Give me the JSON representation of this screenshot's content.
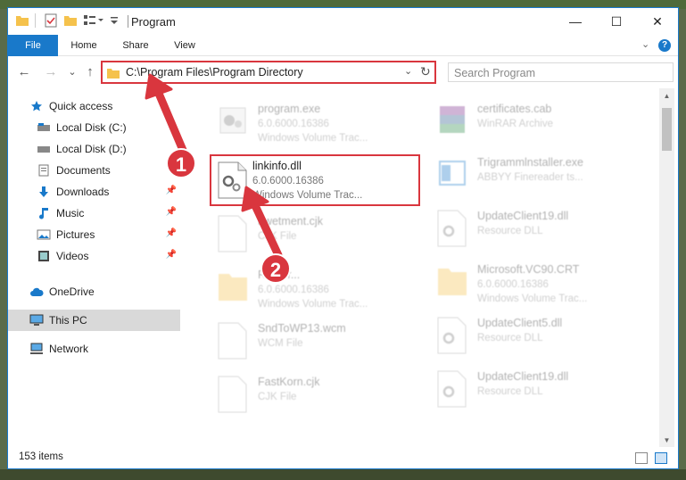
{
  "window": {
    "title": "Program",
    "controls": {
      "minimize": "—",
      "maximize": "☐",
      "close": "✕"
    }
  },
  "ribbon": {
    "tabs": [
      {
        "label": "File"
      },
      {
        "label": "Home"
      },
      {
        "label": "Share"
      },
      {
        "label": "View"
      }
    ],
    "expand": "⌄",
    "help": "?"
  },
  "navigation": {
    "back": "←",
    "forward": "→",
    "recent": "⌄",
    "up": "↑",
    "address": "C:\\Program Files\\Program Directory",
    "address_dropdown": "⌄",
    "refresh": "↻",
    "search_placeholder": "Search Program"
  },
  "sidebar": {
    "items": [
      {
        "label": "Quick access",
        "icon": "star-icon",
        "pinned": false
      },
      {
        "label": "Local Disk (C:)",
        "icon": "drive-icon",
        "pinned": false
      },
      {
        "label": "Local Disk (D:)",
        "icon": "drive-icon",
        "pinned": false
      },
      {
        "label": "Documents",
        "icon": "document-icon",
        "pinned": false
      },
      {
        "label": "Downloads",
        "icon": "download-icon",
        "pinned": true
      },
      {
        "label": "Music",
        "icon": "music-icon",
        "pinned": true
      },
      {
        "label": "Pictures",
        "icon": "picture-icon",
        "pinned": true
      },
      {
        "label": "Videos",
        "icon": "video-icon",
        "pinned": true
      },
      {
        "label": "OneDrive",
        "icon": "cloud-icon",
        "pinned": false
      },
      {
        "label": "This PC",
        "icon": "computer-icon",
        "pinned": false,
        "selected": true
      },
      {
        "label": "Network",
        "icon": "network-icon",
        "pinned": false
      }
    ]
  },
  "files": {
    "left": [
      {
        "name": "program.exe",
        "line2": "6.0.6000.16386",
        "line3": "Windows Volume Trac...",
        "icon": "exe-icon"
      },
      {
        "name": "linkinfo.dll",
        "line2": "6.0.6000.16386",
        "line3": "Windows Volume Trac...",
        "icon": "dll-icon",
        "highlighted": true
      },
      {
        "name": "hwetment.cjk",
        "line2": "CJK File",
        "line3": "",
        "icon": "file-icon"
      },
      {
        "name": "Roamr...",
        "line2": "6.0.6000.16386",
        "line3": "Windows Volume Trac...",
        "icon": "folder-icon"
      },
      {
        "name": "SndToWP13.wcm",
        "line2": "WCM File",
        "line3": "",
        "icon": "file-icon"
      },
      {
        "name": "FastKorn.cjk",
        "line2": "CJK File",
        "line3": "",
        "icon": "file-icon"
      }
    ],
    "right": [
      {
        "name": "certificates.cab",
        "line2": "WinRAR Archive",
        "line3": "",
        "icon": "archive-icon"
      },
      {
        "name": "Trigrammlnstaller.exe",
        "line2": "ABBYY Finereader ts...",
        "line3": "",
        "icon": "installer-icon"
      },
      {
        "name": "UpdateClient19.dll",
        "line2": "Resource DLL",
        "line3": "",
        "icon": "dll-icon"
      },
      {
        "name": "Microsoft.VC90.CRT",
        "line2": "6.0.6000.16386",
        "line3": "Windows Volume Trac...",
        "icon": "folder-icon"
      },
      {
        "name": "UpdateClient5.dll",
        "line2": "Resource DLL",
        "line3": "",
        "icon": "dll-icon"
      },
      {
        "name": "UpdateClient19.dll",
        "line2": "Resource DLL",
        "line3": "",
        "icon": "dll-icon"
      }
    ]
  },
  "status": {
    "count": "153 items"
  },
  "annotations": [
    {
      "label": "1"
    },
    {
      "label": "2"
    }
  ],
  "colors": {
    "accent": "#1979ca",
    "annotation": "#d9363e",
    "selected": "#d9d9d9"
  }
}
